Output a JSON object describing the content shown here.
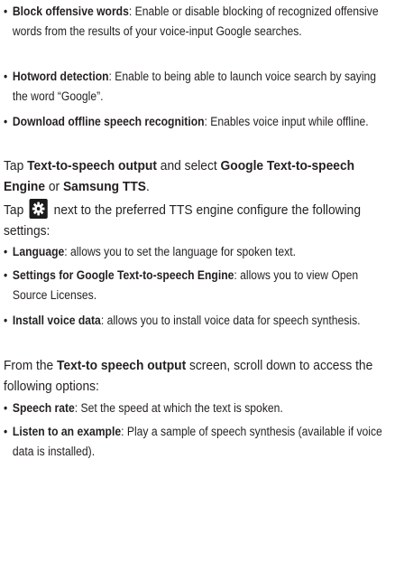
{
  "items": [
    {
      "b": "Block offensive words",
      "t": ": Enable or disable blocking of recognized offensive words from the results of your voice-input Google searches."
    },
    {
      "b": "Hotword detection",
      "t": ": Enable to being able to launch voice search by saying the word “Google”."
    },
    {
      "b": "Download offline speech recognition",
      "t": ": Enables voice input while offline."
    },
    {
      "p1": "Tap ",
      "b1": "Text-to-speech output",
      "p2": " and select ",
      "b2": "Google Text-to-speech Engine",
      "p3": " or ",
      "b3": "Samsung TTS",
      "p4": "."
    },
    {
      "p1": "Tap ",
      "icon": "settings-gear-icon",
      "p2": " next to the preferred TTS engine configure the following settings:"
    },
    {
      "b": "Language",
      "t": ": allows you to set the language for spoken text."
    },
    {
      "b": "Settings for Google Text-to-speech Engine",
      "t": ": allows you to view Open Source Licenses."
    },
    {
      "b": "Install voice data",
      "t": ": allows you to install voice data for speech synthesis."
    },
    {
      "p1": "From the ",
      "b1": "Text-to speech output",
      "p2": " screen, scroll down to access the following options:"
    },
    {
      "b": "Speech rate",
      "t": ": Set the speed at which the text is spoken."
    },
    {
      "b": "Listen to an example",
      "t": ": Play a sample of speech synthesis (available if voice data is installed)."
    }
  ],
  "bullet_char": "•",
  "colors": {
    "text": "#231f20",
    "icon_bg": "#1a1a1a",
    "icon_fg": "#ffffff"
  }
}
